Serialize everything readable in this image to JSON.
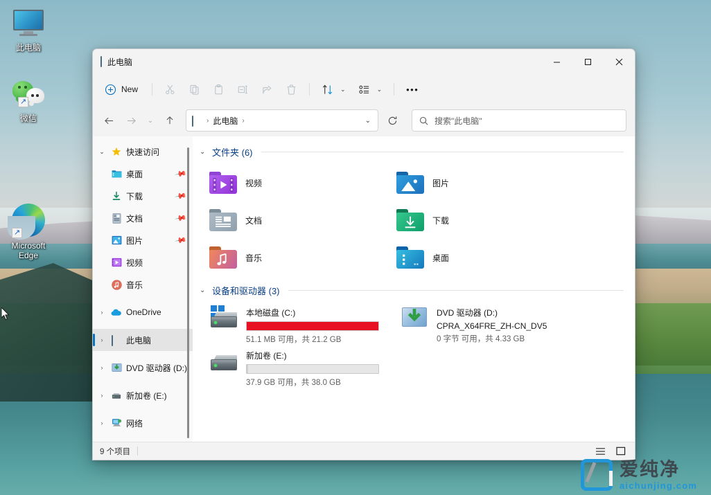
{
  "desktop": {
    "icons": [
      {
        "name": "此电脑",
        "icon": "monitor-icon"
      },
      {
        "name": "微信",
        "icon": "wechat-icon"
      },
      {
        "name": "Microsoft Edge",
        "icon": "edge-icon"
      }
    ]
  },
  "window": {
    "title": "此电脑",
    "title_icon": "this-pc-icon",
    "controls": {
      "minimize": "—",
      "maximize": "▢",
      "close": "✕"
    }
  },
  "toolbar": {
    "new_label": "New",
    "new_plus": "+",
    "items": [
      {
        "name": "cut-icon",
        "tooltip": "剪切"
      },
      {
        "name": "copy-icon",
        "tooltip": "复制"
      },
      {
        "name": "paste-icon",
        "tooltip": "粘贴"
      },
      {
        "name": "rename-icon",
        "tooltip": "重命名"
      },
      {
        "name": "share-icon",
        "tooltip": "共享"
      },
      {
        "name": "delete-icon",
        "tooltip": "删除"
      }
    ],
    "sort_caret": "⌄",
    "view_caret": "⌄",
    "more": "•••"
  },
  "addressbar": {
    "back": "←",
    "forward": "→",
    "recent_caret": "⌄",
    "up": "↑",
    "crumb_icon": "this-pc-icon",
    "crumb": "此电脑",
    "crumb_sep": "›",
    "dropdown_caret": "⌄",
    "refresh": "⟳"
  },
  "search": {
    "placeholder": "搜索\"此电脑\"",
    "icon": "search-icon"
  },
  "sidebar": {
    "items": [
      {
        "label": "快速访问",
        "icon": "star-icon",
        "chevron": "⌄",
        "expanded": true,
        "indent": false,
        "pinned": false,
        "selected": false
      },
      {
        "label": "桌面",
        "icon": "desktop-folder-icon",
        "chevron": "",
        "indent": true,
        "pinned": true,
        "selected": false
      },
      {
        "label": "下载",
        "icon": "downloads-icon",
        "chevron": "",
        "indent": true,
        "pinned": true,
        "selected": false
      },
      {
        "label": "文档",
        "icon": "documents-icon",
        "chevron": "",
        "indent": true,
        "pinned": true,
        "selected": false
      },
      {
        "label": "图片",
        "icon": "pictures-icon",
        "chevron": "",
        "indent": true,
        "pinned": true,
        "selected": false
      },
      {
        "label": "视频",
        "icon": "videos-icon",
        "chevron": "",
        "indent": true,
        "pinned": false,
        "selected": false
      },
      {
        "label": "音乐",
        "icon": "music-icon",
        "chevron": "",
        "indent": true,
        "pinned": false,
        "selected": false
      },
      {
        "label": "OneDrive",
        "icon": "onedrive-icon",
        "chevron": "›",
        "indent": false,
        "pinned": false,
        "selected": false
      },
      {
        "label": "此电脑",
        "icon": "this-pc-icon",
        "chevron": "›",
        "indent": false,
        "pinned": false,
        "selected": true
      },
      {
        "label": "DVD 驱动器 (D:)",
        "icon": "dvd-icon",
        "chevron": "›",
        "indent": false,
        "pinned": false,
        "selected": false
      },
      {
        "label": "新加卷 (E:)",
        "icon": "drive-icon",
        "chevron": "›",
        "indent": false,
        "pinned": false,
        "selected": false
      },
      {
        "label": "网络",
        "icon": "network-icon",
        "chevron": "›",
        "indent": false,
        "pinned": false,
        "selected": false
      }
    ]
  },
  "content": {
    "folders_group": {
      "title": "文件夹 (6)",
      "chevron": "⌄",
      "items": [
        {
          "name": "视频",
          "icon": "videos-folder-icon"
        },
        {
          "name": "图片",
          "icon": "pictures-folder-icon"
        },
        {
          "name": "文档",
          "icon": "documents-folder-icon"
        },
        {
          "name": "下载",
          "icon": "downloads-folder-icon"
        },
        {
          "name": "音乐",
          "icon": "music-folder-icon"
        },
        {
          "name": "桌面",
          "icon": "desktop-folder-icon"
        }
      ]
    },
    "drives_group": {
      "title": "设备和驱动器 (3)",
      "chevron": "⌄",
      "items": [
        {
          "name": "本地磁盘 (C:)",
          "icon": "system-drive-icon",
          "volume_label": "",
          "capacity_text": "51.1 MB 可用，共 21.2 GB",
          "used_percent": 100,
          "bar_color": "#e81123",
          "has_meter": true
        },
        {
          "name": "DVD 驱动器 (D:)",
          "icon": "dvd-drive-icon",
          "volume_label": "CPRA_X64FRE_ZH-CN_DV5",
          "capacity_text": "0 字节 可用，共 4.33 GB",
          "used_percent": 0,
          "bar_color": "",
          "has_meter": false
        },
        {
          "name": "新加卷 (E:)",
          "icon": "drive-icon",
          "volume_label": "",
          "capacity_text": "37.9 GB 可用，共 38.0 GB",
          "used_percent": 1,
          "bar_color": "#d0d0d0",
          "has_meter": true
        }
      ]
    }
  },
  "statusbar": {
    "item_count": "9 个项目",
    "details_view_icon": "details-view-icon",
    "tiles_view_icon": "tiles-view-icon"
  },
  "watermark": {
    "cn": "爱纯净",
    "en": "aichunjing.com",
    "accent": "#2196d8"
  }
}
